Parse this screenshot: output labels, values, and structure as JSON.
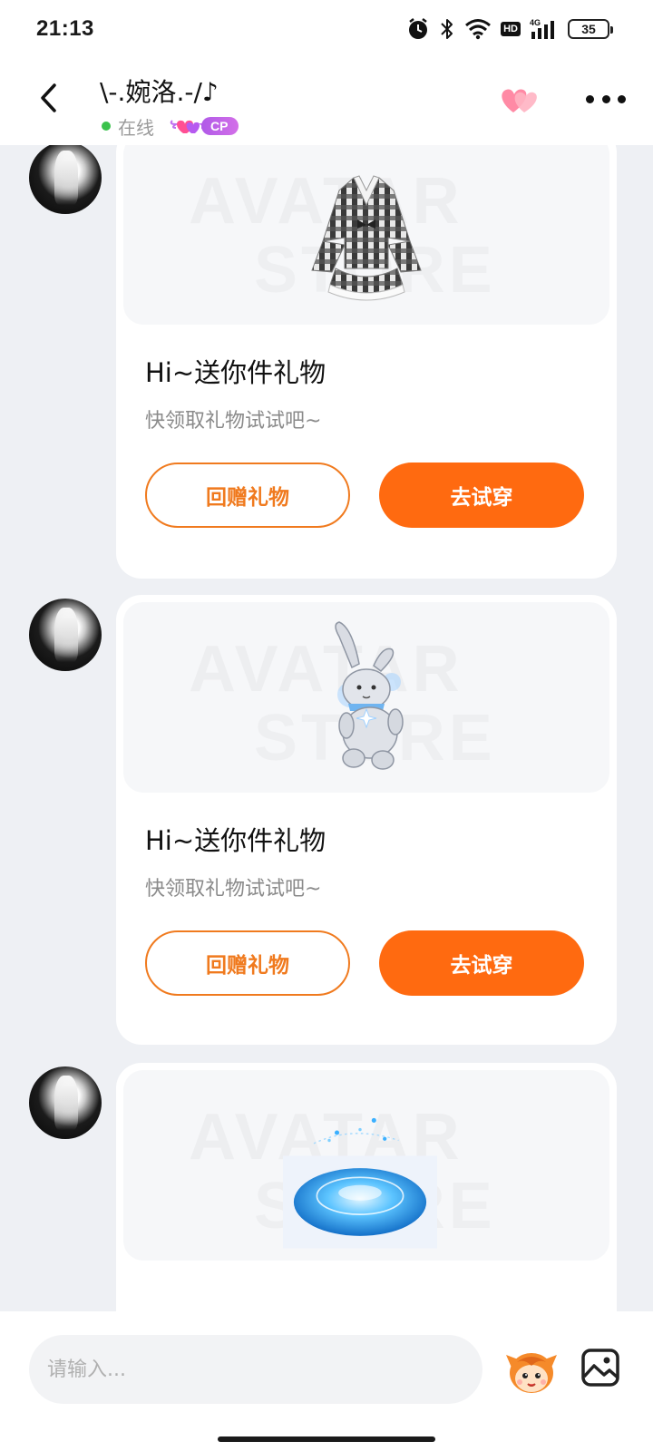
{
  "status_bar": {
    "time": "21:13",
    "network": "4G",
    "hd": "HD",
    "battery": "35"
  },
  "header": {
    "contact_name": "\\-.婉洛.-/♪",
    "online_status": "在线",
    "cp_badge": "CP"
  },
  "messages": [
    {
      "gift_icon": "plaid-dress",
      "title": "Hi~送你件礼物",
      "subtitle": "快领取礼物试试吧~",
      "return_gift_label": "回赠礼物",
      "try_on_label": "去试穿"
    },
    {
      "gift_icon": "bunny-plush",
      "title": "Hi~送你件礼物",
      "subtitle": "快领取礼物试试吧~",
      "return_gift_label": "回赠礼物",
      "try_on_label": "去试穿"
    },
    {
      "gift_icon": "blue-magic-platform"
    }
  ],
  "watermark": {
    "line1": "AVATAR",
    "line2": "STORE"
  },
  "input": {
    "placeholder": "请输入..."
  },
  "colors": {
    "accent_orange": "#ff6a10",
    "outline_orange": "#f07a1e",
    "online_green": "#3bc24c",
    "cp_purple": "#b05ae8"
  }
}
